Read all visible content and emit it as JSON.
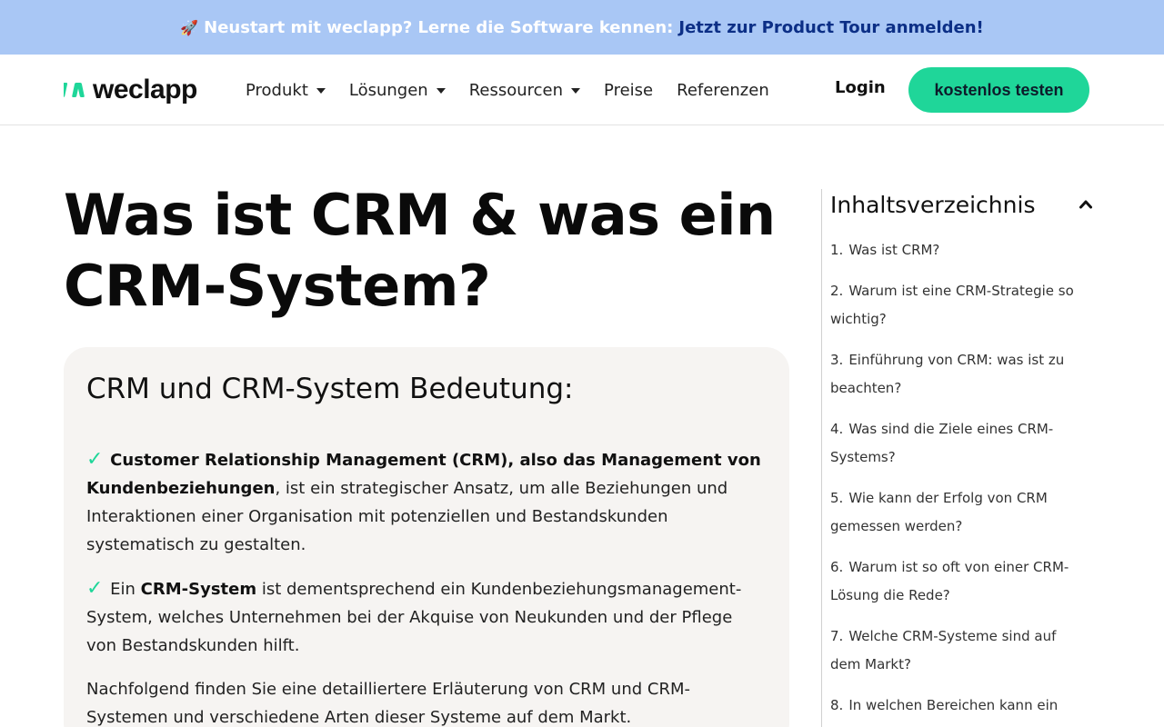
{
  "banner": {
    "rocket": "🚀",
    "lead": "Neustart mit weclapp? Lerne die Software kennen:",
    "cta": "Jetzt zur Product Tour anmelden!",
    "bg_color": "#a9c7f5",
    "cta_color": "#0c2f86"
  },
  "navbar": {
    "logo_text": "weclapp",
    "items": [
      {
        "label": "Produkt",
        "has_dropdown": true
      },
      {
        "label": "Lösungen",
        "has_dropdown": true
      },
      {
        "label": "Ressourcen",
        "has_dropdown": true
      },
      {
        "label": "Preise",
        "has_dropdown": false
      },
      {
        "label": "Referenzen",
        "has_dropdown": false
      }
    ],
    "login": "Login",
    "cta": "kostenlos testen",
    "accent_color": "#1fd699"
  },
  "article": {
    "title_line1": "Was ist CRM & was ein",
    "title_line2": "CRM-System?"
  },
  "card": {
    "heading": "CRM und CRM-System Bedeutung:",
    "check_mark": "✓",
    "p1_bold": "Customer Relationship Management (CRM), also das Management von Kundenbeziehungen",
    "p1_rest": ", ist ein strategischer Ansatz, um alle Beziehungen und Interaktionen einer Organisation mit potenziellen und Bestandskunden systematisch zu gestalten.",
    "p2_pre": " Ein ",
    "p2_bold": "CRM-System",
    "p2_rest": " ist dementsprechend ein Kundenbeziehungsmanagement-System, welches Unternehmen bei der Akquise von Neukunden und der Pflege von Bestandskunden hilft.",
    "p3": "Nachfolgend finden Sie eine detailliertere Erläuterung von CRM und CRM-Systemen und verschiedene Arten dieser Systeme auf dem Markt."
  },
  "toc": {
    "title": "Inhaltsverzeichnis",
    "items": [
      {
        "num": "1.",
        "label": "Was ist CRM?"
      },
      {
        "num": "2.",
        "label": "Warum ist eine CRM-Strategie so wichtig?"
      },
      {
        "num": "3.",
        "label": "Einführung von CRM: was ist zu beachten?"
      },
      {
        "num": "4.",
        "label": "Was sind die Ziele eines CRM-Systems?"
      },
      {
        "num": "5.",
        "label": "Wie kann der Erfolg von CRM gemessen werden?"
      },
      {
        "num": "6.",
        "label": "Warum ist so oft von einer CRM-Lösung die Rede?"
      },
      {
        "num": "7.",
        "label": "Welche CRM-Systeme sind auf dem Markt?"
      },
      {
        "num": "8.",
        "label": "In welchen Bereichen kann ein CRM-"
      }
    ]
  }
}
